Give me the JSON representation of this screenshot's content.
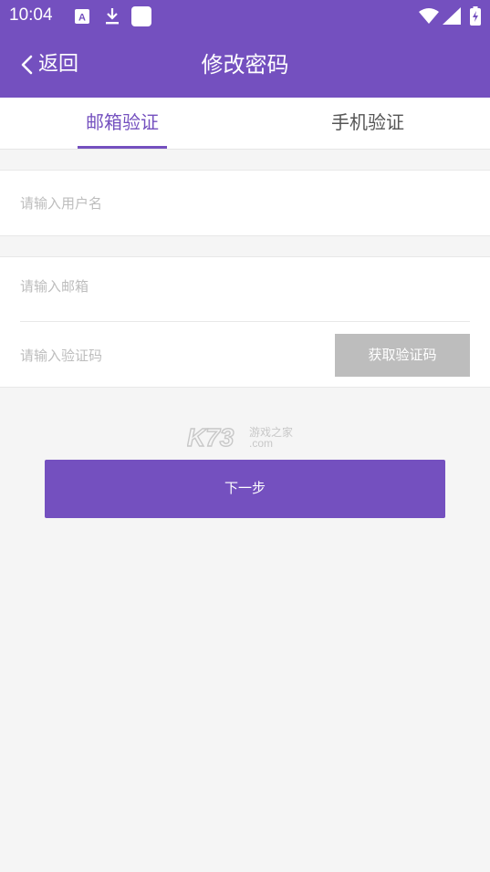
{
  "status_bar": {
    "time": "10:04",
    "icons": [
      "font-badge-icon",
      "download-icon",
      "square-app-icon",
      "wifi-icon",
      "signal-icon",
      "battery-charging-icon"
    ]
  },
  "app_bar": {
    "back_label": "返回",
    "title": "修改密码"
  },
  "tabs": [
    {
      "label": "邮箱验证",
      "active": true
    },
    {
      "label": "手机验证",
      "active": false
    }
  ],
  "form": {
    "username_placeholder": "请输入用户名",
    "email_placeholder": "请输入邮箱",
    "code_placeholder": "请输入验证码",
    "get_code_label": "获取验证码"
  },
  "watermark": {
    "text": "K73",
    "sub_text": "游戏之家",
    "domain": ".com"
  },
  "next_button_label": "下一步",
  "colors": {
    "primary": "#7450bf",
    "disabled": "#bdbdbd",
    "background": "#f5f5f5"
  }
}
